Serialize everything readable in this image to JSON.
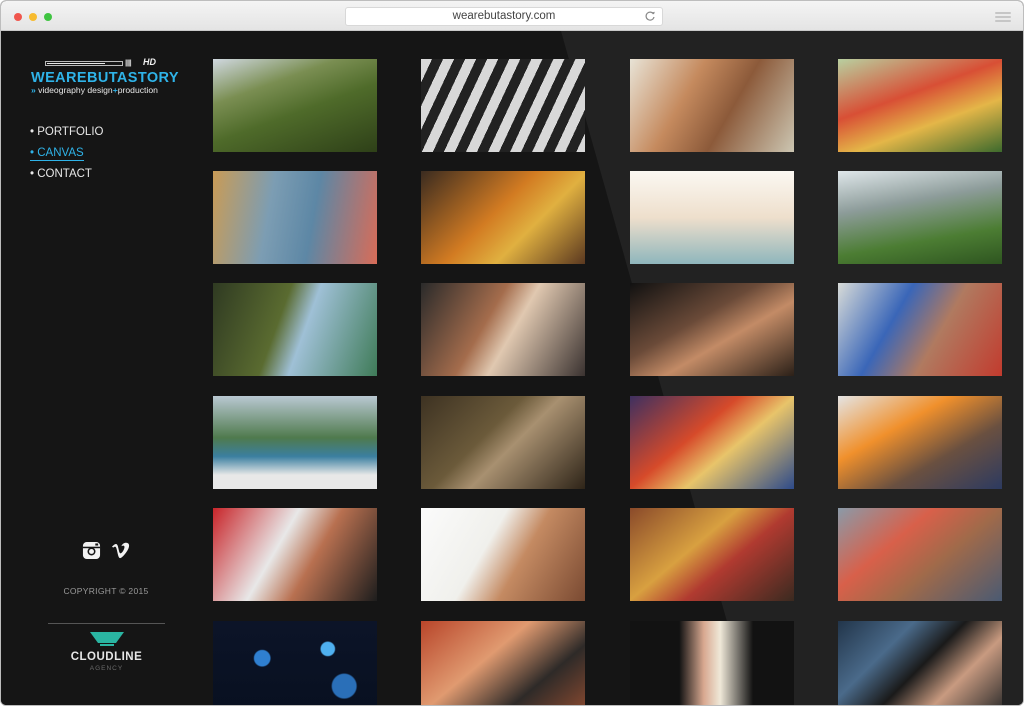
{
  "browser": {
    "url": "wearebutastory.com"
  },
  "logo": {
    "badge": "HD",
    "ticks": "|||||||",
    "word": "WEAREBUTASTORY",
    "subtitle_prefix": "videography design",
    "subtitle_plus": "+",
    "subtitle_suffix": "production"
  },
  "nav": [
    {
      "label": "• PORTFOLIO"
    },
    {
      "label": "• CANVAS",
      "active": true
    },
    {
      "label": "• CONTACT"
    }
  ],
  "social": [
    "instagram-icon",
    "vimeo-icon"
  ],
  "footer": {
    "copyright": "COPYRIGHT © 2015",
    "agency_name": "CLOUDLINE",
    "agency_tag": "AGENCY"
  },
  "colors": {
    "accent": "#2fb3e8",
    "background": "#151515"
  },
  "gallery": [
    {
      "name": "jungle-zipline",
      "bg": "linear-gradient(160deg,#d0d8e0 0%,#7a8e52 30%,#4f6b2a 55%,#2e4018 100%)"
    },
    {
      "name": "xylophone-keys",
      "bg": "repeating-linear-gradient(115deg,#d8d8d8 0 10px,#222 10px 20px)"
    },
    {
      "name": "man-tattoo",
      "bg": "linear-gradient(120deg,#e8e3d6 0%,#c58a5e 35%,#8c5a3a 60%,#ccc6b2 100%)"
    },
    {
      "name": "parade-crowd",
      "bg": "linear-gradient(160deg,#b8d0a0 0%,#d84f35 40%,#e4b648 65%,#3d6a2d 100%)"
    },
    {
      "name": "lake-view-girl",
      "bg": "linear-gradient(100deg,#c99b56 0%,#7c9db3 35%,#5d87a5 60%,#d86c58 100%)"
    },
    {
      "name": "drums",
      "bg": "linear-gradient(135deg,#3a2b20 0%,#d27b22 45%,#e0b040 65%,#5a3820 100%)"
    },
    {
      "name": "beach-dancer",
      "bg": "linear-gradient(180deg,#fbf8f2 0%,#eedfcc 50%,#8fb6bc 100%)"
    },
    {
      "name": "mountain-rock",
      "bg": "linear-gradient(170deg,#dfe7ea 0%,#8d9c9a 35%,#4c7d33 70%,#2e5520 100%)"
    },
    {
      "name": "plant-lake",
      "bg": "linear-gradient(110deg,#2f3a22 0%,#5a6b30 40%,#9fc0d6 55%,#3f7b58 100%)"
    },
    {
      "name": "face-painting",
      "bg": "linear-gradient(120deg,#2a2a2a 0%,#a46c4c 40%,#e0c8b0 55%,#3a3230 100%)"
    },
    {
      "name": "dancer-skirt",
      "bg": "linear-gradient(150deg,#111 0%,#6a4a38 40%,#c38b66 60%,#2b2018 100%)"
    },
    {
      "name": "festival-woman",
      "bg": "linear-gradient(120deg,#d8dbd8 0%,#3a66b8 35%,#b07a60 60%,#c23b2e 100%)"
    },
    {
      "name": "reservoir-balcony",
      "bg": "linear-gradient(180deg,#b9c8d2 0%,#4f7a4d 45%,#3b7fa0 65%,#e8e8e8 85%)"
    },
    {
      "name": "traveler-ruins",
      "bg": "linear-gradient(135deg,#3d3222 0%,#6b5a3a 40%,#a89070 55%,#2e2418 100%)"
    },
    {
      "name": "sombrero-man",
      "bg": "linear-gradient(140deg,#3e3060 0%,#d64a2a 40%,#e8c46a 60%,#2d4a8a 100%)"
    },
    {
      "name": "child-shoulders",
      "bg": "linear-gradient(150deg,#e4e4e4 0%,#f0902c 35%,#6a5040 65%,#2c3a60 100%)"
    },
    {
      "name": "flute-player",
      "bg": "linear-gradient(120deg,#c8252a 0%,#e8e8e8 40%,#b87050 60%,#1d1d1d 100%)"
    },
    {
      "name": "camera-man",
      "bg": "linear-gradient(120deg,#fbfbfb 0%,#f0f0ec 40%,#c48a62 60%,#7a4a32 100%)"
    },
    {
      "name": "tribal-dancers",
      "bg": "linear-gradient(140deg,#8a4a2a 0%,#d8a040 40%,#b03a30 60%,#3a2a20 100%)"
    },
    {
      "name": "street-festival",
      "bg": "linear-gradient(140deg,#8a9aa8 0%,#d8604a 35%,#a06a4a 60%,#4a5a72 100%)"
    },
    {
      "name": "blue-lights",
      "bg": "radial-gradient(circle at 30% 40%,#2f7fd0 0 6%,transparent 7%),radial-gradient(circle at 70% 30%,#4fb0f0 0 5%,transparent 6%),radial-gradient(circle at 80% 70%,#2a6fb8 0 8%,transparent 9%),linear-gradient(#0c1428,#081020)"
    },
    {
      "name": "surprised-woman",
      "bg": "linear-gradient(140deg,#b8452a 0%,#e09a70 40%,#2e2a28 70%,#8a4a30 100%)"
    },
    {
      "name": "runway-model",
      "bg": "linear-gradient(90deg,#121212 0%,#121212 30%,#d8a890 45%,#efe8d8 55%,#121212 75%)"
    },
    {
      "name": "sunglasses-model",
      "bg": "linear-gradient(135deg,#22354a 0%,#4a6a8a 30%,#1a1a1a 50%,#c89a80 70%,#2a2a2a 100%)"
    }
  ]
}
